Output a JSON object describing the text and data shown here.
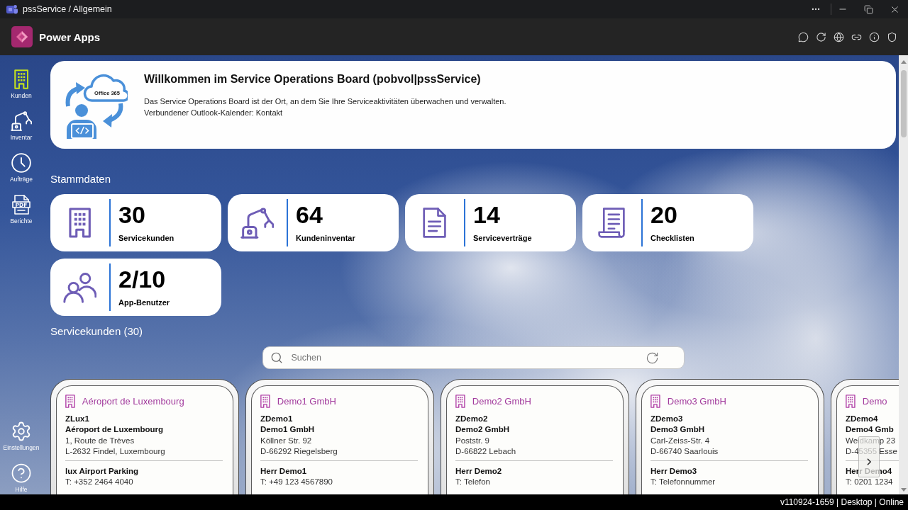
{
  "window": {
    "title": "pssService / Allgemein"
  },
  "app_bar": {
    "title": "Power Apps"
  },
  "sidebar": {
    "items": [
      {
        "kind": "building",
        "label": "Kunden",
        "selected": true
      },
      {
        "kind": "robot-arm",
        "label": "Inventar",
        "selected": false
      },
      {
        "kind": "clock",
        "label": "Aufträge",
        "selected": false
      },
      {
        "kind": "pdf",
        "label": "Berichte",
        "badge": "PDF",
        "selected": false
      }
    ],
    "footer_items": [
      {
        "kind": "gear",
        "label": "Einstellungen",
        "selected": false
      },
      {
        "kind": "help",
        "label": "Hilfe",
        "selected": false
      }
    ]
  },
  "welcome": {
    "title": "Willkommen im Service Operations Board (pobvol|pssService)",
    "lines": [
      "Das Service Operations Board ist der Ort, an dem Sie Ihre Serviceaktivitäten überwachen und verwalten.",
      "Verbundener Outlook-Kalender: Kontakt"
    ],
    "illustration_label": "Office 365"
  },
  "master_data": {
    "heading": "Stammdaten",
    "tiles": [
      {
        "kind": "building",
        "value": "30",
        "label": "Servicekunden"
      },
      {
        "kind": "robot-arm",
        "value": "64",
        "label": "Kundeninventar"
      },
      {
        "kind": "document",
        "value": "14",
        "label": "Serviceverträge"
      },
      {
        "kind": "checklist",
        "value": "20",
        "label": "Checklisten"
      },
      {
        "kind": "users",
        "value": "2/10",
        "label": "App-Benutzer"
      }
    ]
  },
  "customers": {
    "heading": "Servicekunden (30)",
    "search": {
      "placeholder": "Suchen"
    },
    "cards": [
      {
        "name": "Aéroport de Luxembourg",
        "code": "ZLux1",
        "company": "Aéroport de Luxembourg",
        "street": "1, Route de Trèves",
        "city": "L-2632 Findel, Luxembourg",
        "contact": "lux Airport Parking",
        "phone": "T: +352 2464 4040"
      },
      {
        "name": "Demo1 GmbH",
        "code": "ZDemo1",
        "company": "Demo1 GmbH",
        "street": "Köllner Str. 92",
        "city": "D-66292 Riegelsberg",
        "contact": "Herr Demo1",
        "phone": "T: +49 123 4567890"
      },
      {
        "name": "Demo2 GmbH",
        "code": "ZDemo2",
        "company": "Demo2 GmbH",
        "street": "Poststr. 9",
        "city": "D-66822 Lebach",
        "contact": "Herr Demo2",
        "phone": "T: Telefon"
      },
      {
        "name": "Demo3 GmbH",
        "code": "ZDemo3",
        "company": "Demo3 GmbH",
        "street": "Carl-Zeiss-Str. 4",
        "city": "D-66740 Saarlouis",
        "contact": "Herr Demo3",
        "phone": "T: Telefonnummer"
      },
      {
        "name": "Demo",
        "code": "ZDemo4",
        "company": "Demo4 Gmb",
        "street": "Weidkamp 23",
        "city": "D-45355 Esse",
        "contact": "Herr Demo4",
        "phone": "T: 0201 1234"
      }
    ]
  },
  "status_bar": {
    "text": "v110924-1659 | Desktop | Online"
  }
}
